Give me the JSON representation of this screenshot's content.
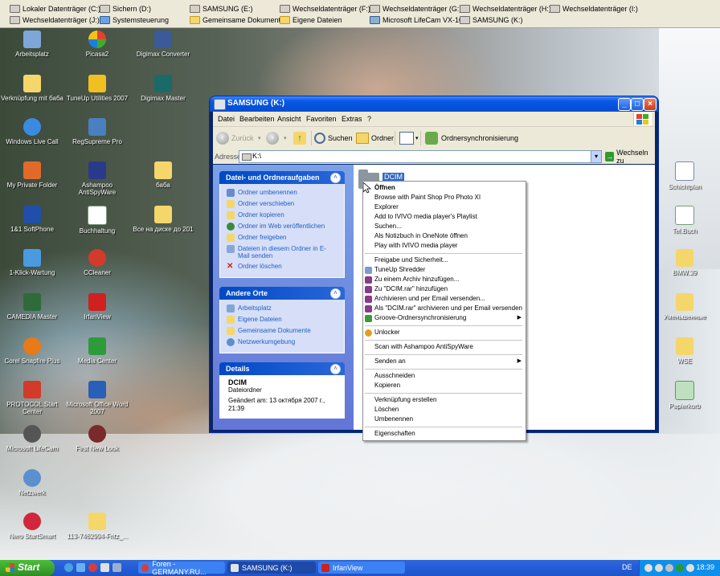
{
  "top_toolbar": {
    "row1": [
      {
        "label": "Lokaler Datenträger (C:)",
        "icon": "drive-icon"
      },
      {
        "label": "Sichern (D:)",
        "icon": "drive-icon"
      },
      {
        "label": "SAMSUNG (E:)",
        "icon": "drive-icon"
      },
      {
        "label": "Wechseldatenträger (F:)",
        "icon": "drive-icon"
      },
      {
        "label": "Wechseldatenträger (G:)",
        "icon": "drive-icon"
      },
      {
        "label": "Wechseldatenträger (H:)",
        "icon": "drive-icon"
      },
      {
        "label": "Wechseldatenträger (I:)",
        "icon": "drive-icon"
      }
    ],
    "row2": [
      {
        "label": "Wechseldatenträger (J:)",
        "icon": "drive-icon"
      },
      {
        "label": "Systemsteuerung",
        "icon": "control-panel-icon"
      },
      {
        "label": "Gemeinsame Dokumente",
        "icon": "folder-icon"
      },
      {
        "label": "Eigene Dateien",
        "icon": "folder-icon"
      },
      {
        "label": "Microsoft LifeCam VX-10...",
        "icon": "webcam-icon"
      },
      {
        "label": "SAMSUNG (K:)",
        "icon": "drive-icon"
      }
    ]
  },
  "desktop_icons": {
    "col1": [
      "Arbeitsplatz",
      "Verknüpfung mit баба",
      "Windows Live Call",
      "My Private Folder",
      "1&1 SoftPhone",
      "1-Klick-Wartung",
      "CAMEDIA Master",
      "Corel Snapfire Plus",
      "PROTOCOL Start Center",
      "Microsoft LifeCam",
      "Netzwerk",
      "Nero StartSmart"
    ],
    "col2": [
      "Picasa2",
      "TuneUp Utilities 2007",
      "RegSupreme Pro",
      "Ashampoo AntiSpyWare",
      "Buchhaltung",
      "CCleaner",
      "IrfanView",
      "Media Center",
      "Microsoft Office Word 2007",
      "First New Look",
      "113-7462994-Fritz_..."
    ],
    "col3": [
      "Digimax Converter",
      "Digimax Master",
      "баба",
      "Все на диске до 201"
    ],
    "col4": [
      "Schichtplan",
      "Tel.Buch",
      "BMW.39",
      "Уменьшенные",
      "WSE",
      "Papierkorb"
    ]
  },
  "window": {
    "title": "SAMSUNG (K:)",
    "menu": [
      "Datei",
      "Bearbeiten",
      "Ansicht",
      "Favoriten",
      "Extras",
      "?"
    ],
    "toolbar": {
      "back": "Zurück",
      "search": "Suchen",
      "folders": "Ordner",
      "sync": "Ordnersynchronisierung"
    },
    "address": {
      "label": "Adresse",
      "value": "K:\\",
      "go": "Wechseln zu"
    },
    "tasks_panel": {
      "title": "Datei- und Ordneraufgaben",
      "items": [
        "Ordner umbenennen",
        "Ordner verschieben",
        "Ordner kopieren",
        "Ordner im Web veröffentlichen",
        "Ordner freigeben",
        "Dateien in diesem Ordner in E-Mail senden",
        "Ordner löschen"
      ]
    },
    "places_panel": {
      "title": "Andere Orte",
      "items": [
        "Arbeitsplatz",
        "Eigene Dateien",
        "Gemeinsame Dokumente",
        "Netzwerkumgebung"
      ]
    },
    "details_panel": {
      "title": "Details",
      "name": "DCIM",
      "type": "Dateiordner",
      "modified": "Geändert am: 13 октября 2007 г., 21:39"
    },
    "folder_name": "DCIM"
  },
  "context_menu": {
    "items": [
      "Öffnen",
      "Browse with Paint Shop Pro Photo XI",
      "Explorer",
      "Add to IVIVO media player's Playlist",
      "Suchen...",
      "Als Notizbuch in OneNote öffnen",
      "Play with IVIVO media player",
      "Freigabe und Sicherheit...",
      "TuneUp Shredder",
      "Zu einem Archiv hinzufügen...",
      "Zu \"DCIM.rar\" hinzufügen",
      "Archivieren und per Email versenden...",
      "Als \"DCIM.rar\" archivieren und per Email versenden",
      "Groove-Ordnersynchronisierung",
      "Unlocker",
      "Scan with Ashampoo AntiSpyWare",
      "Senden an",
      "Ausschneiden",
      "Kopieren",
      "Verknüpfung erstellen",
      "Löschen",
      "Umbenennen",
      "Eigenschaften"
    ]
  },
  "taskbar": {
    "start": "Start",
    "tasks": [
      "Foren - GERMANY.RU...",
      "SAMSUNG (K:)",
      "IrfanView"
    ],
    "language": "DE",
    "clock": "18:39"
  },
  "colors": {
    "taskbar": "#245edb",
    "start": "#3c9a2c",
    "title_bar": "#0a58e6",
    "task_pane": "#6f8fe0",
    "link": "#215dc6"
  }
}
